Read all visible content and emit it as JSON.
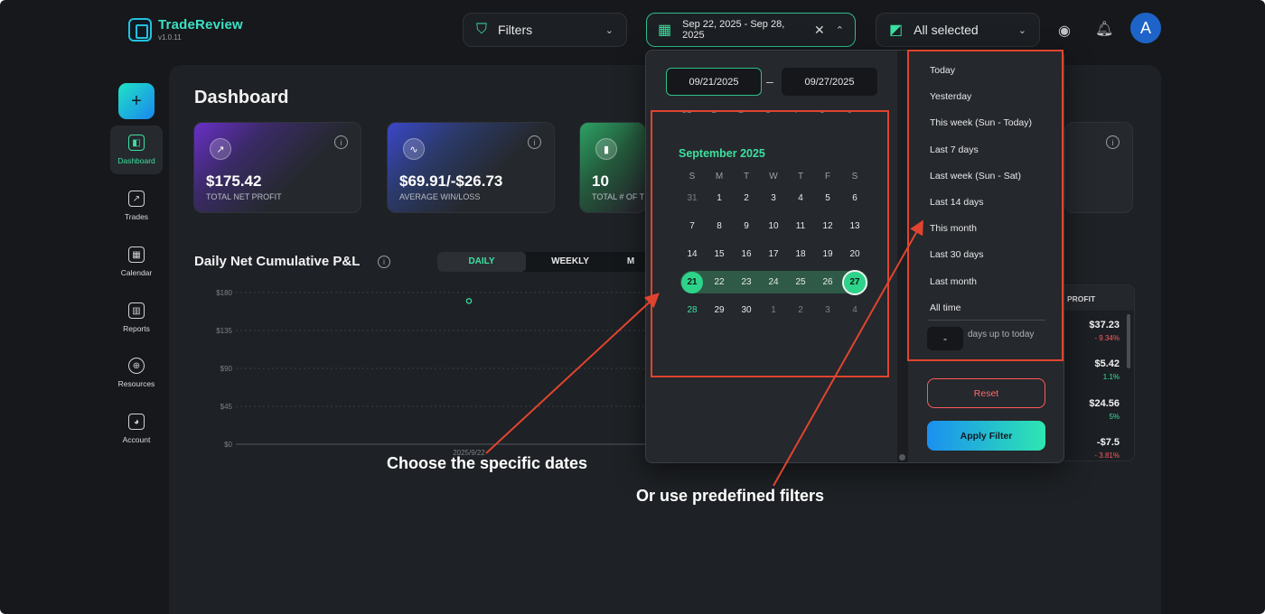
{
  "app": {
    "name": "TradeReview",
    "version": "v1.0.11"
  },
  "header": {
    "filters_label": "Filters",
    "date_range": "Sep 22, 2025 - Sep 28, 2025",
    "accounts_label": "All selected",
    "avatar_initial": "A"
  },
  "sidebar": {
    "new_label": "+",
    "items": [
      {
        "label": "Dashboard",
        "icon": "dashboard-icon"
      },
      {
        "label": "Trades",
        "icon": "trades-icon"
      },
      {
        "label": "Calendar",
        "icon": "calendar-icon"
      },
      {
        "label": "Reports",
        "icon": "reports-icon"
      },
      {
        "label": "Resources",
        "icon": "globe-icon"
      },
      {
        "label": "Account",
        "icon": "user-icon"
      }
    ]
  },
  "dashboard": {
    "title": "Dashboard",
    "cards": [
      {
        "value": "$175.42",
        "label": "TOTAL NET PROFIT",
        "icon": "trend-up-icon"
      },
      {
        "value": "$69.91/-$26.73",
        "label": "AVERAGE WIN/LOSS",
        "icon": "pulse-icon"
      },
      {
        "value": "10",
        "label": "TOTAL # OF T",
        "icon": "bar-chart-icon"
      }
    ],
    "chart_title": "Daily Net Cumulative P&L",
    "tabs": [
      "DAILY",
      "WEEKLY",
      "M"
    ],
    "active_tab": "DAILY"
  },
  "chart_data": {
    "type": "line",
    "title": "Daily Net Cumulative P&L",
    "y_ticks": [
      "$180",
      "$135",
      "$90",
      "$45",
      "$0"
    ],
    "ylim": [
      0,
      180
    ],
    "x": [
      "2025/9/22"
    ],
    "series": [
      {
        "values": [
          170
        ]
      }
    ],
    "grid": true
  },
  "table_fragment": {
    "header": "PROFIT",
    "rows": [
      {
        "value": "$37.23",
        "pct": "- 9.34%",
        "sign": "neg"
      },
      {
        "value": "$5.42",
        "pct": "1.1%",
        "sign": "pos"
      },
      {
        "value": "$24.56",
        "pct": "5%",
        "sign": "pos"
      },
      {
        "value": "-$7.5",
        "pct": "- 3.81%",
        "sign": "neg"
      }
    ]
  },
  "picker": {
    "start_date": "09/21/2025",
    "end_date": "09/27/2025",
    "separator": "–",
    "prev_row": [
      "31",
      "1",
      "2",
      "3",
      "4",
      "5",
      "6"
    ],
    "month": "September 2025",
    "weekdays": [
      "S",
      "M",
      "T",
      "W",
      "T",
      "F",
      "S"
    ],
    "weeks": [
      [
        "31",
        "1",
        "2",
        "3",
        "4",
        "5",
        "6"
      ],
      [
        "7",
        "8",
        "9",
        "10",
        "11",
        "12",
        "13"
      ],
      [
        "14",
        "15",
        "16",
        "17",
        "18",
        "19",
        "20"
      ],
      [
        "21",
        "22",
        "23",
        "24",
        "25",
        "26",
        "27"
      ],
      [
        "28",
        "29",
        "30",
        "1",
        "2",
        "3",
        "4"
      ]
    ],
    "presets": [
      "Today",
      "Yesterday",
      "This week (Sun - Today)",
      "Last 7 days",
      "Last week (Sun - Sat)",
      "Last 14 days",
      "This month",
      "Last 30 days",
      "Last month",
      "All time"
    ],
    "days_value": "-",
    "days_label": "days up to today",
    "reset_label": "Reset",
    "apply_label": "Apply Filter"
  },
  "annotations": {
    "left": "Choose the specific dates",
    "right": "Or use predefined filters",
    "color": "#e0442f"
  }
}
